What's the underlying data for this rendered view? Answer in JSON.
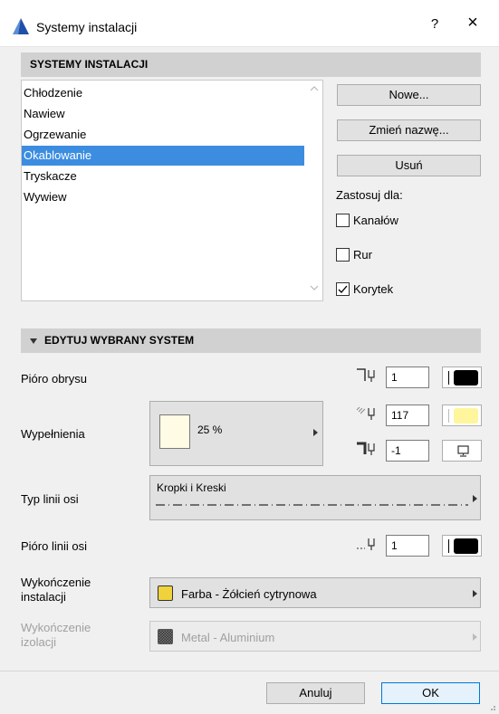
{
  "window": {
    "title": "Systemy instalacji",
    "help_label": "?",
    "close_label": "×"
  },
  "systems_section": {
    "header": "SYSTEMY INSTALACJI",
    "items": [
      "Chłodzenie",
      "Nawiew",
      "Ogrzewanie",
      "Okablowanie",
      "Tryskacze",
      "Wywiew"
    ],
    "selected_index": 3,
    "buttons": {
      "new": "Nowe...",
      "rename": "Zmień nazwę...",
      "delete": "Usuń"
    },
    "apply_for_label": "Zastosuj dla:",
    "checkboxes": [
      {
        "label": "Kanałów",
        "checked": false
      },
      {
        "label": "Rur",
        "checked": false
      },
      {
        "label": "Korytek",
        "checked": true
      }
    ]
  },
  "edit_section": {
    "header": "EDYTUJ WYBRANY SYSTEM",
    "outline_pen": {
      "label": "Pióro obrysu",
      "value": "1",
      "color": "#000000"
    },
    "fills": {
      "label": "Wypełnienia",
      "percent": "25 %",
      "fg_pen_value": "117",
      "fg_color": "#fff59d",
      "bg_pen_value": "-1"
    },
    "axis_line_type": {
      "label": "Typ linii osi",
      "value": "Kropki i Kreski"
    },
    "axis_line_pen": {
      "label": "Pióro linii osi",
      "value": "1",
      "color": "#000000"
    },
    "installation_surface": {
      "label_line1": "Wykończenie",
      "label_line2": "instalacji",
      "value": "Farba - Żółcień cytrynowa",
      "color": "#f0d23c"
    },
    "insulation_surface": {
      "label_line1": "Wykończenie",
      "label_line2": "izolacji",
      "value": "Metal - Aluminium",
      "enabled": false
    }
  },
  "footer": {
    "cancel": "Anuluj",
    "ok": "OK"
  }
}
